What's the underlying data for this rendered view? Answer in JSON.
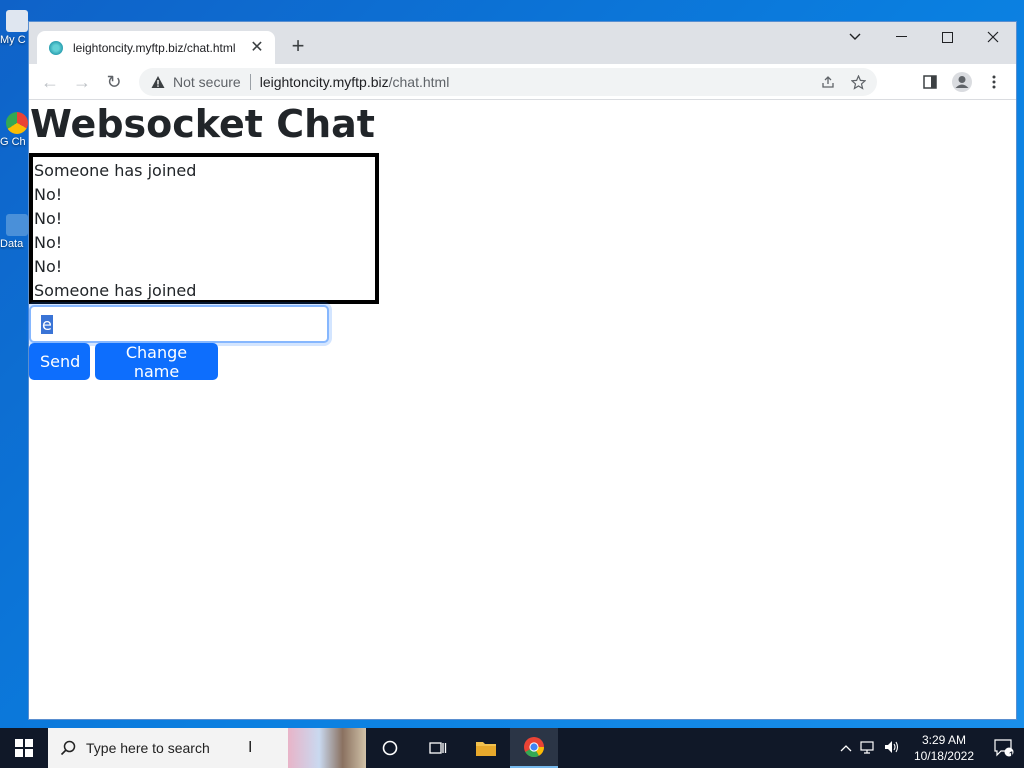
{
  "desktop": {
    "icons": [
      {
        "label": "My C",
        "color": "#dfe6f0"
      },
      {
        "label": "G Ch",
        "color": "#34a853"
      },
      {
        "label": "Data",
        "color": "#4a90d9"
      }
    ]
  },
  "browser": {
    "tab": {
      "title": "leightoncity.myftp.biz/chat.html",
      "close_glyph": "✕",
      "favicon": "site-favicon"
    },
    "new_tab_glyph": "+",
    "window_controls": {
      "dropdown": "⌄",
      "minimize": "—",
      "maximize": "☐",
      "close": "✕"
    },
    "nav": {
      "back": "←",
      "forward": "→",
      "reload": "↻"
    },
    "address": {
      "security_label": "Not secure",
      "host": "leightoncity.myftp.biz",
      "path": "/chat.html"
    }
  },
  "page": {
    "title": "Websocket Chat",
    "messages": [
      "Someone has joined",
      "No!",
      "No!",
      "No!",
      "No!",
      "Someone has joined"
    ],
    "input_value": "e",
    "send_label": "Send",
    "change_name_label": "Change name"
  },
  "taskbar": {
    "search_placeholder": "Type here to search",
    "clock_time": "3:29 AM",
    "clock_date": "10/18/2022",
    "notification_count": "1"
  },
  "colors": {
    "accent": "#0d6efd",
    "taskbar": "#101828",
    "desktop": "#0a78d4"
  }
}
